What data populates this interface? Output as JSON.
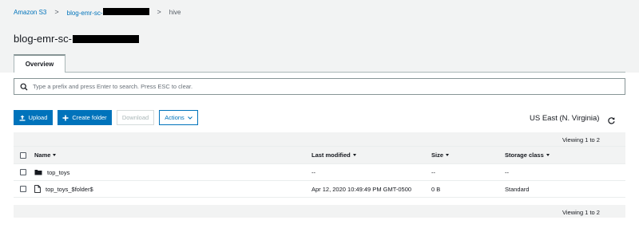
{
  "breadcrumb": {
    "root": "Amazon S3",
    "bucket": "blog-emr-sc-",
    "current": "hive",
    "separator": ">"
  },
  "bucket_title": "blog-emr-sc-",
  "tabs": [
    {
      "label": "Overview",
      "active": true
    }
  ],
  "search": {
    "placeholder": "Type a prefix and press Enter to search. Press ESC to clear.",
    "value": ""
  },
  "toolbar": {
    "upload_label": "Upload",
    "create_folder_label": "Create folder",
    "download_label": "Download",
    "actions_label": "Actions"
  },
  "region": "US East (N. Virginia)",
  "viewing_top": "Viewing 1 to 2",
  "viewing_bottom": "Viewing 1 to 2",
  "table": {
    "headers": {
      "name": "Name",
      "last_modified": "Last modified",
      "size": "Size",
      "storage_class": "Storage class"
    },
    "rows": [
      {
        "name": "top_toys",
        "type": "folder",
        "last_modified": "--",
        "size": "--",
        "storage_class": "--"
      },
      {
        "name": "top_toys_$folder$",
        "type": "file",
        "last_modified": "Apr 12, 2020 10:49:49 PM GMT-0500",
        "size": "0 B",
        "storage_class": "Standard"
      }
    ]
  },
  "colors": {
    "accent": "#0073bb",
    "background_band": "#f2f3f3",
    "text": "#16191f",
    "disabled": "#aab7b8"
  },
  "icons": {
    "search": "search-icon",
    "upload": "upload-icon",
    "create_folder": "plus-icon",
    "actions_chevron": "chevron-down-icon",
    "refresh": "refresh-icon",
    "folder": "folder-icon",
    "file": "file-icon"
  }
}
